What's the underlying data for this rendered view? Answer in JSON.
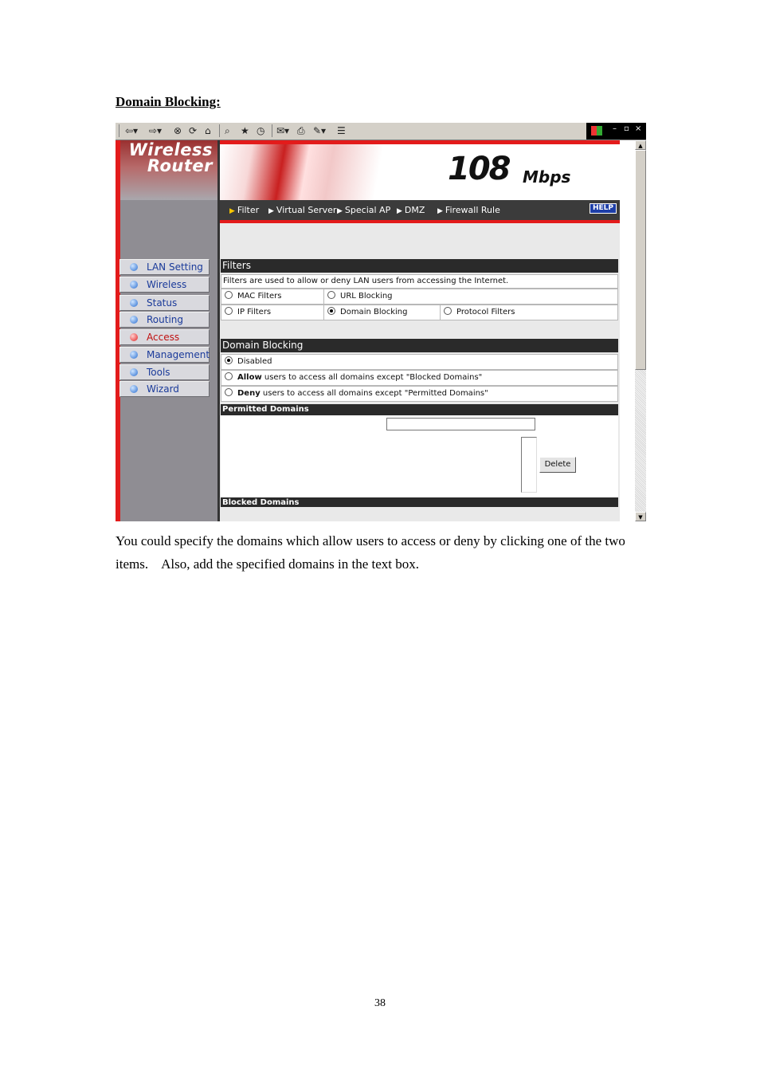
{
  "doc": {
    "heading": "Domain Blocking:",
    "paragraph": "You could specify the domains which allow users to access or deny by clicking one of the two items.    Also, add the specified domains in the text box.",
    "page_number": "38"
  },
  "browser": {
    "toolbar_icons": [
      "back-icon",
      "forward-icon",
      "stop-icon",
      "refresh-icon",
      "home-icon",
      "search-icon",
      "favorites-icon",
      "history-icon",
      "mail-icon",
      "print-icon",
      "edit-icon",
      "discuss-icon"
    ],
    "window_controls": {
      "minimize": "–",
      "restore": "▫",
      "close": "×"
    }
  },
  "router": {
    "logo_line1": "Wireless",
    "logo_line2": "Router",
    "banner_speed": "108",
    "banner_unit": "Mbps",
    "help_label": "HELP",
    "top_menu": [
      "Filter",
      "Virtual Server",
      "Special AP",
      "DMZ",
      "Firewall Rule"
    ],
    "sidebar": [
      {
        "label": "LAN Setting",
        "active": false
      },
      {
        "label": "Wireless",
        "active": false
      },
      {
        "label": "Status",
        "active": false
      },
      {
        "label": "Routing",
        "active": false
      },
      {
        "label": "Access",
        "active": true
      },
      {
        "label": "Management",
        "active": false
      },
      {
        "label": "Tools",
        "active": false
      },
      {
        "label": "Wizard",
        "active": false
      }
    ],
    "filters": {
      "title": "Filters",
      "description": "Filters are used to allow or deny LAN users from accessing the Internet.",
      "options": {
        "mac": "MAC Filters",
        "url": "URL Blocking",
        "ip": "IP Filters",
        "domain": "Domain Blocking",
        "protocol": "Protocol Filters"
      },
      "selected": "Domain Blocking"
    },
    "domain_blocking": {
      "title": "Domain Blocking",
      "disabled": "Disabled",
      "allow_bold": "Allow",
      "allow_rest": " users to access all domains except \"Blocked Domains\"",
      "deny_bold": "Deny",
      "deny_rest": " users to access all domains except \"Permitted Domains\"",
      "selected": "Disabled"
    },
    "permitted": {
      "title": "Permitted Domains",
      "input_value": "",
      "delete_label": "Delete"
    },
    "blocked": {
      "title": "Blocked Domains"
    }
  }
}
